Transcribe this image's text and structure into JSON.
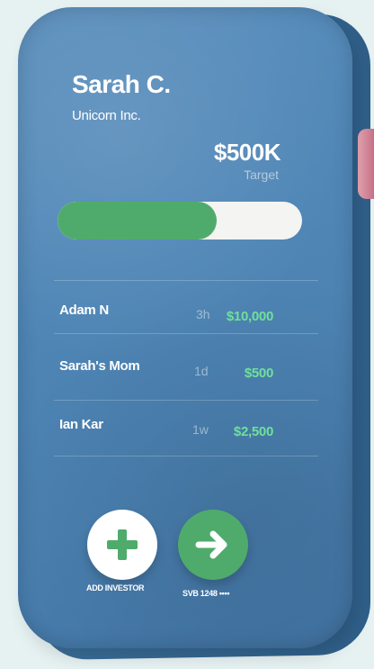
{
  "profile": {
    "name": "Sarah C.",
    "company": "Unicorn Inc."
  },
  "goal": {
    "amount": "$500K",
    "label": "Target",
    "progress_fraction": 0.65
  },
  "investors": [
    {
      "name": "Adam N",
      "time": "3h",
      "amount": "$10,000"
    },
    {
      "name": "Sarah's Mom",
      "time": "1d",
      "amount": "$500"
    },
    {
      "name": "Ian Kar",
      "time": "1w",
      "amount": "$2,500"
    }
  ],
  "actions": {
    "add_label": "ADD INVESTOR",
    "account_label": "SVB 1248 ••••"
  },
  "colors": {
    "device": "#4f86b6",
    "accent_green": "#4fab6c",
    "amount_green": "#6fe09a",
    "side_button": "#d98b9c"
  },
  "icons": {
    "add": "plus-icon",
    "go": "arrow-right-icon"
  }
}
